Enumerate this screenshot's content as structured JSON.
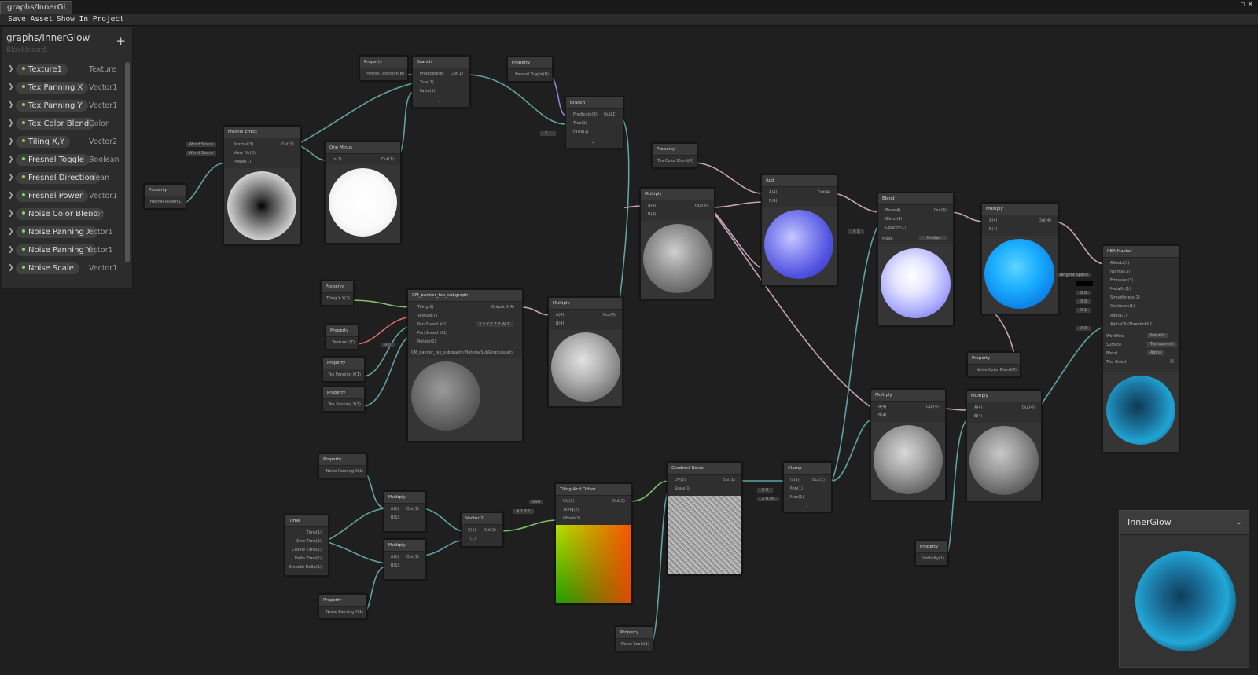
{
  "window": {
    "tab_title": "graphs/InnerGl",
    "controls": "▫ ✕"
  },
  "toolbar": {
    "save_label": "Save Asset",
    "show_label": "Show In Project"
  },
  "blackboard": {
    "title": "graphs/InnerGlow",
    "subtitle": "Blackboard",
    "add_label": "+",
    "items": [
      {
        "name": "Texture1",
        "type": "Texture"
      },
      {
        "name": "Tex Panning X",
        "type": "Vector1"
      },
      {
        "name": "Tex Panning Y",
        "type": "Vector1"
      },
      {
        "name": "Tex Color Blend",
        "type": "Color"
      },
      {
        "name": "Tiling X,Y",
        "type": "Vector2"
      },
      {
        "name": "Fresnel Toggle",
        "type": "Boolean"
      },
      {
        "name": "Fresnel Direction",
        "type": "olean"
      },
      {
        "name": "Fresnel Power",
        "type": "Vector1"
      },
      {
        "name": "Noise Color Blend",
        "type": "olor"
      },
      {
        "name": "Noise Panning X",
        "type": "ector1"
      },
      {
        "name": "Noise Panning Y",
        "type": "ector1"
      },
      {
        "name": "Noise Scale",
        "type": "Vector1"
      }
    ]
  },
  "nodes": {
    "prop_fresnel_dir": {
      "title": "Property",
      "out": "Fresnel Direction(B)"
    },
    "branch1": {
      "title": "Branch",
      "inputs": [
        "Predicate(B)",
        "True(1)",
        "False(1)"
      ],
      "out": "Out(1)"
    },
    "prop_fresnel_toggle": {
      "title": "Property",
      "out": "Fresnel Toggle(B)"
    },
    "branch2": {
      "title": "Branch",
      "inputs": [
        "Predicate(B)",
        "True(1)",
        "False(1)"
      ],
      "out": "Out(1)",
      "false_val": "X 1"
    },
    "fresnel": {
      "title": "Fresnel Effect",
      "inputs": [
        "Normal(3)",
        "View Dir(3)",
        "Power(1)"
      ],
      "out": "Out(1)",
      "normal_space": "World Space",
      "view_space": "World Space"
    },
    "one_minus": {
      "title": "One Minus",
      "input": "In(1)",
      "out": "Out(1)"
    },
    "prop_fresnel_power": {
      "title": "Property",
      "out": "Fresnel Power(1)"
    },
    "prop_tex_color": {
      "title": "Property",
      "out": "Tex Color Blend(4)"
    },
    "add": {
      "title": "Add",
      "inputs": [
        "A(4)",
        "B(4)"
      ],
      "out": "Out(4)"
    },
    "multiply_tex": {
      "title": "Multiply",
      "inputs": [
        "A(4)",
        "B(4)"
      ],
      "out": "Out(4)"
    },
    "blend": {
      "title": "Blend",
      "inputs": [
        "Base(4)",
        "Blend(4)",
        "Opacity(1)"
      ],
      "out": "Out(4)",
      "opacity_val": "X 1",
      "mode_label": "Mode",
      "mode_value": "Dodge"
    },
    "multiply_blue": {
      "title": "Multiply",
      "inputs": [
        "A(4)",
        "B(4)"
      ],
      "out": "Out(4)"
    },
    "pbr": {
      "title": "PBR Master",
      "inputs": [
        "Albedo(3)",
        "Normal(3)",
        "Emission(3)",
        "Metallic(1)",
        "Smoothness(1)",
        "Occlusion(1)",
        "Alpha(1)",
        "AlphaClipThreshold(1)"
      ],
      "normal_space": "Tangent Space",
      "metallic_val": "X 0",
      "smooth_val": "X 0",
      "occl_val": "X 1",
      "clip_val": "X 0",
      "settings": [
        {
          "label": "Workflow",
          "value": "Metallic"
        },
        {
          "label": "Surface",
          "value": "Transparent"
        },
        {
          "label": "Blend",
          "value": "Alpha"
        },
        {
          "label": "Two Sided",
          "value": ""
        }
      ]
    },
    "prop_tiling": {
      "title": "Property",
      "out": "Tiling X,Y(2)"
    },
    "subgraph": {
      "title": "CM_panner_tex_subgraph",
      "inputs": [
        "Tiling(2)",
        "Texture(T)",
        "Pan Speed X(1)",
        "Pan Speed Y(1)",
        "Rotate(1)"
      ],
      "out": "Output 1(4)",
      "asset": "CM_panner_tex_subgraph (MaterialSubGraphAsset)",
      "rotate_val": "X 0",
      "xyzw": "X 2   Y 2   Z 2   W 2"
    },
    "multiply_sub": {
      "title": "Multiply",
      "inputs": [
        "A(4)",
        "B(4)"
      ],
      "out": "Out(4)"
    },
    "prop_texture": {
      "title": "Property",
      "out": "Texture1(T)"
    },
    "prop_tex_pan_x": {
      "title": "Property",
      "out": "Tex Panning X(1)"
    },
    "prop_tex_pan_y": {
      "title": "Property",
      "out": "Tex Panning Y(1)"
    },
    "prop_noise_color": {
      "title": "Property",
      "out": "Noise Color Blend(4)"
    },
    "multiply_noise1": {
      "title": "Multiply",
      "inputs": [
        "A(4)",
        "B(4)"
      ],
      "out": "Out(4)"
    },
    "multiply_noise2": {
      "title": "Multiply",
      "inputs": [
        "A(4)",
        "B(4)"
      ],
      "out": "Out(4)"
    },
    "prop_noise_pan_x": {
      "title": "Property",
      "out": "Noise Panning X(1)"
    },
    "multiply_t1": {
      "title": "Multiply",
      "inputs": [
        "A(1)",
        "B(1)"
      ],
      "out": "Out(1)"
    },
    "multiply_t2": {
      "title": "Multiply",
      "inputs": [
        "A(1)",
        "B(1)"
      ],
      "out": "Out(1)"
    },
    "time": {
      "title": "Time",
      "outs": [
        "Time(1)",
        "Sine Time(1)",
        "Cosine Time(1)",
        "Delta Time(1)",
        "Smooth Delta(1)"
      ]
    },
    "prop_noise_pan_y": {
      "title": "Property",
      "out": "Noise Panning Y(1)"
    },
    "vector2": {
      "title": "Vector 2",
      "inputs": [
        "X(1)",
        "Y(1)"
      ],
      "out": "Out(2)"
    },
    "tiling_offset": {
      "title": "Tiling And Offset",
      "inputs": [
        "UV(2)",
        "Tiling(2)",
        "Offset(2)"
      ],
      "out": "Out(2)",
      "uv_val": "UV0",
      "tiling_val": "X 1   Y 1"
    },
    "gradient_noise": {
      "title": "Gradient Noise",
      "inputs": [
        "UV(2)",
        "Scale(1)"
      ],
      "out": "Out(1)"
    },
    "clamp": {
      "title": "Clamp",
      "inputs": [
        "In(1)",
        "Min(1)",
        "Max(1)"
      ],
      "out": "Out(1)",
      "min_val": "X 0",
      "max_val": "X 0.99"
    },
    "prop_visibility": {
      "title": "Property",
      "out": "Visibility(1)"
    },
    "prop_noise_scale": {
      "title": "Property",
      "out": "Noise Scale(1)"
    }
  },
  "preview": {
    "title": "InnerGlow",
    "chevron": "⌄"
  },
  "colors": {
    "wire_teal": "#5fa4a0",
    "wire_pink": "#c9a3b8",
    "wire_green": "#7fbf6a",
    "wire_red": "#d86b6b",
    "wire_purple": "#8b86d4",
    "accent_node": "#3a3a3a"
  }
}
